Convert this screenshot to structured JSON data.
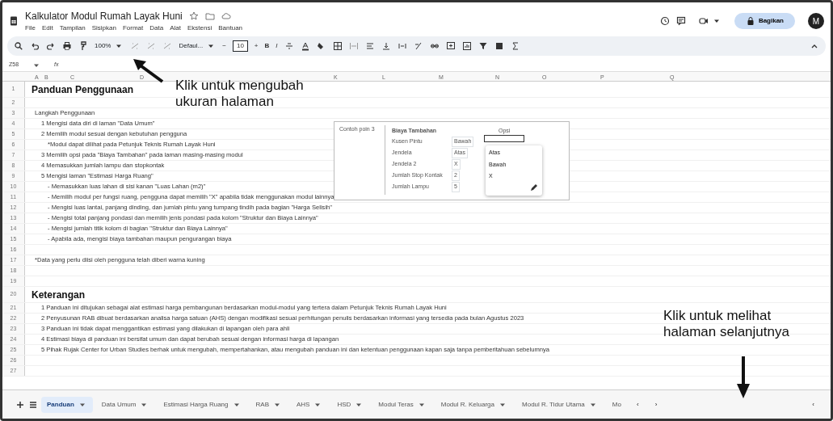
{
  "document": {
    "title": "Kalkulator Modul Rumah Layak Huni",
    "menu": [
      "File",
      "Edit",
      "Tampilan",
      "Sisipkan",
      "Format",
      "Data",
      "Alat",
      "Ekstensi",
      "Bantuan"
    ]
  },
  "header": {
    "share": "Bagikan",
    "avatar": "M"
  },
  "toolbar": {
    "zoom": "100%",
    "font": "Defaul...",
    "font_size": "10",
    "minus": "−",
    "plus": "+",
    "bold": "B",
    "italic": "I"
  },
  "formula_bar": {
    "name_box": "Z58",
    "fx": "fx"
  },
  "column_headers": [
    "A",
    "B",
    "C",
    "D",
    "K",
    "L",
    "M",
    "N",
    "O",
    "P",
    "Q"
  ],
  "rows": [
    {
      "number": "1",
      "kind": "heading",
      "text": "Panduan Penggunaan"
    },
    {
      "number": "2"
    },
    {
      "number": "3",
      "kind": "plain",
      "text": "Langkah Penggunaan"
    },
    {
      "number": "4",
      "kind": "step",
      "text": "1  Mengisi data diri di laman \"Data Umum\""
    },
    {
      "number": "5",
      "kind": "step",
      "text": "2  Memilih modul sesuai dengan kebutuhan pengguna"
    },
    {
      "number": "6",
      "kind": "substep",
      "text": "*Modul dapat dilihat pada Petunjuk Teknis Rumah Layak Huni"
    },
    {
      "number": "7",
      "kind": "step",
      "text": "3  Memilih opsi pada \"Biaya Tambahan\" pada laman masing-masing modul"
    },
    {
      "number": "8",
      "kind": "step",
      "text": "4  Memasukkan jumlah lampu dan stopkontak"
    },
    {
      "number": "9",
      "kind": "step",
      "text": "5  Mengisi laman \"Estimasi Harga Ruang\""
    },
    {
      "number": "10",
      "kind": "substep",
      "text": "- Memasukkan luas lahan di sisi kanan \"Luas Lahan (m2)\""
    },
    {
      "number": "11",
      "kind": "substep",
      "text": "- Memilih modul per fungsi ruang, pengguna dapat memilih \"X\" apabila tidak menggunakan modul lainnya"
    },
    {
      "number": "12",
      "kind": "substep",
      "text": "- Mengisi luas lantai, panjang dinding, dan jumlah pintu yang tumpang tindih pada bagian \"Harga Selisih\""
    },
    {
      "number": "13",
      "kind": "substep",
      "text": "- Mengisi total panjang pondasi dan memilih jenis pondasi pada kolom \"Struktur dan Biaya Lainnya\""
    },
    {
      "number": "14",
      "kind": "substep",
      "text": "- Mengisi jumlah titik kolom di bagian \"Struktur dan Biaya Lainnya\""
    },
    {
      "number": "15",
      "kind": "substep",
      "text": "- Apabila ada, mengisi biaya tambahan maupun pengurangan biaya"
    },
    {
      "number": "16"
    },
    {
      "number": "17",
      "kind": "plain",
      "text": "*Data yang perlu diisi oleh pengguna telah diberi warna kuning"
    },
    {
      "number": "18"
    },
    {
      "number": "19"
    },
    {
      "number": "20",
      "kind": "heading",
      "text": "Keterangan"
    },
    {
      "number": "21",
      "kind": "step",
      "text": "1  Panduan ini ditujukan sebagai alat estimasi harga pembangunan berdasarkan modul-modul yang tertera dalam Petunjuk Teknis Rumah Layak Huni"
    },
    {
      "number": "22",
      "kind": "step",
      "text": "2  Penyusunan RAB dibuat berdasarkan analisa harga satuan (AHS) dengan modifikasi sesuai perhitungan penulis berdasarkan informasi yang tersedia pada bulan Agustus 2023"
    },
    {
      "number": "23",
      "kind": "step",
      "text": "3  Panduan ini tidak dapat menggantikan estimasi yang dilakukan di lapangan oleh para ahli"
    },
    {
      "number": "24",
      "kind": "step",
      "text": "4  Estimasi biaya di panduan ini bersifat umum dan dapat berubah sesuai dengan informasi harga di lapangan"
    },
    {
      "number": "25",
      "kind": "step",
      "text": "5  Pihak Rujak Center for Urban Studies berhak untuk mengubah, mempertahankan, atau mengubah panduan ini dan ketentuan penggunaan kapan saja tanpa pemberitahuan sebelumnya"
    },
    {
      "number": "26"
    },
    {
      "number": "27"
    }
  ],
  "example": {
    "caption": "Contoh poin 3",
    "heading": "Biaya Tambahan",
    "column": "Opsi",
    "items": [
      {
        "label": "Kusen Pintu",
        "value": "Bawah"
      },
      {
        "label": "Jendela",
        "value": "Atas"
      },
      {
        "label": "Jendela 2",
        "value": "X"
      },
      {
        "label": "Jumlah Stop Kontak",
        "value": "2"
      },
      {
        "label": "Jumlah Lampu",
        "value": "5"
      }
    ],
    "options": [
      "Atas",
      "Bawah",
      "X"
    ]
  },
  "annotations": [
    {
      "kind": "zoom",
      "text": "Klik untuk mengubah ukuran halaman"
    },
    {
      "kind": "next",
      "text": "Klik untuk melihat halaman selanjutnya"
    }
  ],
  "sheet_tabs": [
    {
      "label": "Panduan",
      "selected": true
    },
    {
      "label": "Data Umum",
      "selected": false
    },
    {
      "label": "Estimasi Harga Ruang",
      "selected": false
    },
    {
      "label": "RAB",
      "selected": false
    },
    {
      "label": "AHS",
      "selected": false
    },
    {
      "label": "HSD",
      "selected": false
    },
    {
      "label": "Modul Teras",
      "selected": false
    },
    {
      "label": "Modul R. Keluarga",
      "selected": false
    },
    {
      "label": "Modul R. Tidur Utama",
      "selected": false
    },
    {
      "label": "Mo",
      "selected": false
    }
  ],
  "tab_nav": {
    "prev": "‹",
    "next": "›",
    "collapse": "‹"
  }
}
